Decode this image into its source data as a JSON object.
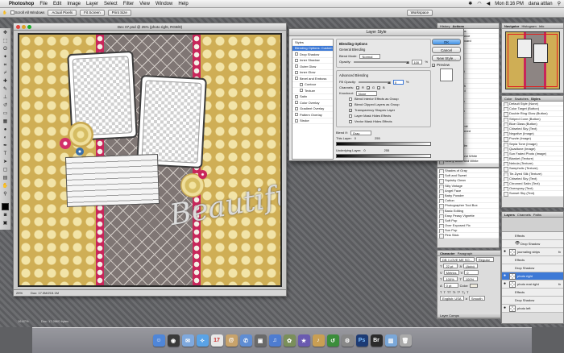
{
  "menubar": {
    "app": "Photoshop",
    "items": [
      "File",
      "Edit",
      "Image",
      "Layer",
      "Select",
      "Filter",
      "View",
      "Window",
      "Help"
    ],
    "clock": "Mon 8:16 PM",
    "user": "dana attlan"
  },
  "options": {
    "scroll_all": "Scroll All Windows",
    "actual_pixels": "Actual Pixels",
    "fit_screen": "Fit Screen",
    "print_size": "Print Size",
    "workspace": "Workspace"
  },
  "document": {
    "title": "Dec 07.psd @ 25% (photo right, RGB/8)",
    "zoom": "25%",
    "doc_size": "Doc: 17.0M/215.1M",
    "script_text": "Beautiful"
  },
  "dialog": {
    "title": "Layer Style",
    "styles": [
      {
        "label": "Styles",
        "checkbox": false
      },
      {
        "label": "Blending Options: Custom",
        "checkbox": false,
        "selected": true
      },
      {
        "label": "Drop Shadow",
        "checkbox": true
      },
      {
        "label": "Inner Shadow",
        "checkbox": true
      },
      {
        "label": "Outer Glow",
        "checkbox": true
      },
      {
        "label": "Inner Glow",
        "checkbox": true
      },
      {
        "label": "Bevel and Emboss",
        "checkbox": true
      },
      {
        "label": "Contour",
        "checkbox": true
      },
      {
        "label": "Texture",
        "checkbox": true
      },
      {
        "label": "Satin",
        "checkbox": true
      },
      {
        "label": "Color Overlay",
        "checkbox": true
      },
      {
        "label": "Gradient Overlay",
        "checkbox": true
      },
      {
        "label": "Pattern Overlay",
        "checkbox": true
      },
      {
        "label": "Stroke",
        "checkbox": true
      }
    ],
    "blending_title": "Blending Options",
    "general_title": "General Blending",
    "blend_mode_label": "Blend Mode:",
    "blend_mode_value": "Normal",
    "opacity_label": "Opacity:",
    "opacity_value": "100",
    "advanced_title": "Advanced Blending",
    "fill_label": "Fill Opacity:",
    "fill_value": "0",
    "channels_label": "Channels:",
    "channels": [
      "R",
      "G",
      "B"
    ],
    "knockout_label": "Knockout:",
    "knockout_value": "None",
    "options": [
      {
        "label": "Blend Interior Effects as Group",
        "checked": false
      },
      {
        "label": "Blend Clipped Layers as Group",
        "checked": true
      },
      {
        "label": "Transparency Shapes Layer",
        "checked": true
      },
      {
        "label": "Layer Mask Hides Effects",
        "checked": false
      },
      {
        "label": "Vector Mask Hides Effects",
        "checked": false
      }
    ],
    "blend_if_label": "Blend If:",
    "blend_if_value": "Gray",
    "this_layer_label": "This Layer:",
    "this_layer_values": [
      "0",
      "255"
    ],
    "underlying_label": "Underlying Layer:",
    "underlying_values": [
      "0",
      "255"
    ],
    "buttons": {
      "ok": "OK",
      "cancel": "Cancel",
      "new_style": "New Style...",
      "preview": "Preview"
    }
  },
  "panels": {
    "history_tabs": [
      "History",
      "Actions"
    ],
    "actions": [
      "Default Actions",
      "Cut and Brilliance",
      "Blue Skies Aboard",
      "Cinnamon",
      "Cool Lotion",
      "Exp and Lift",
      "Glowy",
      "Intense Light",
      "Intense Bright",
      "Lighten",
      "Low Fade",
      "Shadow Booth",
      "Smooth Brood",
      "Sunbeams",
      "Vanilla Cream",
      "Sun Dry",
      "Vanilla Cream",
      "Heaven Skin",
      "Blue Dusk",
      "Dreamy Summit",
      "Sharp Dust Toned",
      "Color Pop",
      "Cool Toned",
      "Fool in Old Film",
      "Sepia Drown",
      "Neely Black and White",
      "Nearly Black and White",
      "Lovely Dry",
      "Reds and Brown",
      "Reds the Bright",
      "Pink Stick"
    ],
    "navigator_tabs": [
      "Navigator",
      "Histogram",
      "Info"
    ],
    "styles_tabs": [
      "Color",
      "Swatches",
      "Styles"
    ],
    "styles_list": [
      "Default Style (None)",
      "Color Target (Button)",
      "Double Ring Glow (Button)",
      "Striped Cone (Button)",
      "Blue Glass (Button)",
      "Chiseled Sky (Text)",
      "Negative (Image)",
      "Puzzle (Image)",
      "Sepia Tone (Image)",
      "Quadtone (Image)",
      "Sun Faded Photo (Image)",
      "Blanket (Texture)",
      "Nebula (Texture)",
      "Sampholic (Texture)",
      "Tie-Dyed Silk (Texture)",
      "Chiseled Sky (Text)",
      "Chromed Satin (Text)",
      "Overspray (Text)",
      "Sunset Sky (Text)"
    ],
    "actions2": [
      "Shades of Gray",
      "Soft and Sweet",
      "Squishy Clean",
      "Silly Vintage",
      "Angel Face",
      "Baby Powder",
      "Cotton",
      "Photographer Tool Box",
      "Basic Editing",
      "Easy Peasy Vignette",
      "Soft Pop",
      "Over Exposed Fix",
      "Sun Pop",
      "Pink Stick"
    ],
    "layers_tabs": [
      "Layers",
      "Channels",
      "Paths"
    ],
    "layers": [
      {
        "label": "Effects",
        "sub": true
      },
      {
        "label": "Drop Shadow",
        "sub": true
      },
      {
        "label": "journaling strips",
        "fx": true
      },
      {
        "label": "Effects",
        "sub": true
      },
      {
        "label": "Drop Shadow",
        "sub": true
      },
      {
        "label": "photo right",
        "selected": true
      },
      {
        "label": "photo mat right",
        "fx": true
      },
      {
        "label": "Effects",
        "sub": true
      },
      {
        "label": "Drop Shadow",
        "sub": true
      },
      {
        "label": "photo left"
      }
    ],
    "character_tabs": [
      "Character",
      "Paragraph"
    ],
    "char_font": "DB I LOVE ME SO...",
    "char_style": "Regular",
    "char_size": "22 pt",
    "char_auto": "(Auto)",
    "char_metrics": "Metrics",
    "char_va": "0",
    "char_scale_v": "100%",
    "char_scale_h": "100%",
    "char_baseline": "0 pt",
    "char_color": "Color:",
    "char_lang": "English: USA",
    "char_aa": "Smooth",
    "layer_comps": "Layer Comps",
    "layer_comps2": "Layers"
  },
  "statusbar": {
    "zoom": "16.67%",
    "doc": "Doc: 17.0M/0 bytes"
  },
  "dock": [
    "Finder",
    "Dashboard",
    "Mail",
    "Safari",
    "iCal",
    "Address Book",
    "iChat",
    "Preview",
    "iTunes",
    "iPhoto",
    "iMovie",
    "GarageBand",
    "Time Machine",
    "System Preferences",
    "Photoshop",
    "Bridge",
    "Documents",
    "Trash"
  ]
}
